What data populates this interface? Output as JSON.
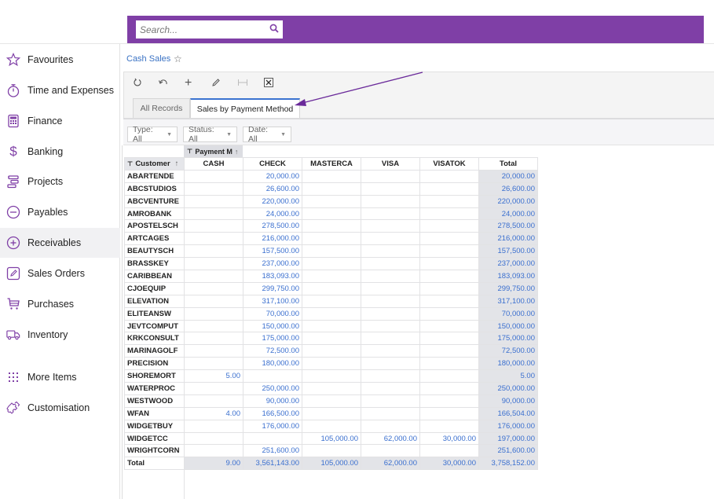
{
  "header": {
    "search_placeholder": "Search...",
    "brand_color": "#7f3fa6"
  },
  "sidebar": {
    "items": [
      {
        "label": "Favourites",
        "icon": "star-icon"
      },
      {
        "label": "Time and Expenses",
        "icon": "stopwatch-icon"
      },
      {
        "label": "Finance",
        "icon": "calculator-icon"
      },
      {
        "label": "Banking",
        "icon": "dollar-icon"
      },
      {
        "label": "Projects",
        "icon": "projects-icon"
      },
      {
        "label": "Payables",
        "icon": "minus-circle-icon"
      },
      {
        "label": "Receivables",
        "icon": "plus-circle-icon",
        "active": true
      },
      {
        "label": "Sales Orders",
        "icon": "edit-icon"
      },
      {
        "label": "Purchases",
        "icon": "cart-icon"
      },
      {
        "label": "Inventory",
        "icon": "truck-icon"
      },
      {
        "label": "More Items",
        "icon": "grid-dots-icon"
      },
      {
        "label": "Customisation",
        "icon": "puzzle-icon"
      }
    ]
  },
  "page": {
    "breadcrumb": "Cash Sales",
    "toolbar": [
      "refresh",
      "undo",
      "add",
      "edit",
      "fit-columns",
      "export-excel"
    ],
    "tabs": [
      {
        "label": "All Records",
        "active": false
      },
      {
        "label": "Sales by Payment Method",
        "active": true
      }
    ],
    "filters": [
      {
        "label": "Type: All"
      },
      {
        "label": "Status: All"
      },
      {
        "label": "Date: All"
      }
    ]
  },
  "pivot": {
    "column_field": "Payment M",
    "row_field": "Customer",
    "columns": [
      "CASH",
      "CHECK",
      "MASTERCA",
      "VISA",
      "VISATOK",
      "Total"
    ],
    "rows": [
      {
        "customer": "ABARTENDE",
        "values": [
          "",
          "20,000.00",
          "",
          "",
          "",
          "20,000.00"
        ]
      },
      {
        "customer": "ABCSTUDIOS",
        "values": [
          "",
          "26,600.00",
          "",
          "",
          "",
          "26,600.00"
        ]
      },
      {
        "customer": "ABCVENTURE",
        "values": [
          "",
          "220,000.00",
          "",
          "",
          "",
          "220,000.00"
        ]
      },
      {
        "customer": "AMROBANK",
        "values": [
          "",
          "24,000.00",
          "",
          "",
          "",
          "24,000.00"
        ]
      },
      {
        "customer": "APOSTELSCH",
        "values": [
          "",
          "278,500.00",
          "",
          "",
          "",
          "278,500.00"
        ]
      },
      {
        "customer": "ARTCAGES",
        "values": [
          "",
          "216,000.00",
          "",
          "",
          "",
          "216,000.00"
        ]
      },
      {
        "customer": "BEAUTYSCH",
        "values": [
          "",
          "157,500.00",
          "",
          "",
          "",
          "157,500.00"
        ]
      },
      {
        "customer": "BRASSKEY",
        "values": [
          "",
          "237,000.00",
          "",
          "",
          "",
          "237,000.00"
        ]
      },
      {
        "customer": "CARIBBEAN",
        "values": [
          "",
          "183,093.00",
          "",
          "",
          "",
          "183,093.00"
        ]
      },
      {
        "customer": "CJOEQUIP",
        "values": [
          "",
          "299,750.00",
          "",
          "",
          "",
          "299,750.00"
        ]
      },
      {
        "customer": "ELEVATION",
        "values": [
          "",
          "317,100.00",
          "",
          "",
          "",
          "317,100.00"
        ]
      },
      {
        "customer": "ELITEANSW",
        "values": [
          "",
          "70,000.00",
          "",
          "",
          "",
          "70,000.00"
        ]
      },
      {
        "customer": "JEVTCOMPUT",
        "values": [
          "",
          "150,000.00",
          "",
          "",
          "",
          "150,000.00"
        ]
      },
      {
        "customer": "KRKCONSULT",
        "values": [
          "",
          "175,000.00",
          "",
          "",
          "",
          "175,000.00"
        ]
      },
      {
        "customer": "MARINAGOLF",
        "values": [
          "",
          "72,500.00",
          "",
          "",
          "",
          "72,500.00"
        ]
      },
      {
        "customer": "PRECISION",
        "values": [
          "",
          "180,000.00",
          "",
          "",
          "",
          "180,000.00"
        ]
      },
      {
        "customer": "SHOREMORT",
        "values": [
          "5.00",
          "",
          "",
          "",
          "",
          "5.00"
        ]
      },
      {
        "customer": "WATERPROC",
        "values": [
          "",
          "250,000.00",
          "",
          "",
          "",
          "250,000.00"
        ]
      },
      {
        "customer": "WESTWOOD",
        "values": [
          "",
          "90,000.00",
          "",
          "",
          "",
          "90,000.00"
        ]
      },
      {
        "customer": "WFAN",
        "values": [
          "4.00",
          "166,500.00",
          "",
          "",
          "",
          "166,504.00"
        ]
      },
      {
        "customer": "WIDGETBUY",
        "values": [
          "",
          "176,000.00",
          "",
          "",
          "",
          "176,000.00"
        ]
      },
      {
        "customer": "WIDGETCC",
        "values": [
          "",
          "",
          "105,000.00",
          "62,000.00",
          "30,000.00",
          "197,000.00"
        ]
      },
      {
        "customer": "WRIGHTCORN",
        "values": [
          "",
          "251,600.00",
          "",
          "",
          "",
          "251,600.00"
        ]
      }
    ],
    "total": {
      "label": "Total",
      "values": [
        "9.00",
        "3,561,143.00",
        "105,000.00",
        "62,000.00",
        "30,000.00",
        "3,758,152.00"
      ]
    }
  }
}
